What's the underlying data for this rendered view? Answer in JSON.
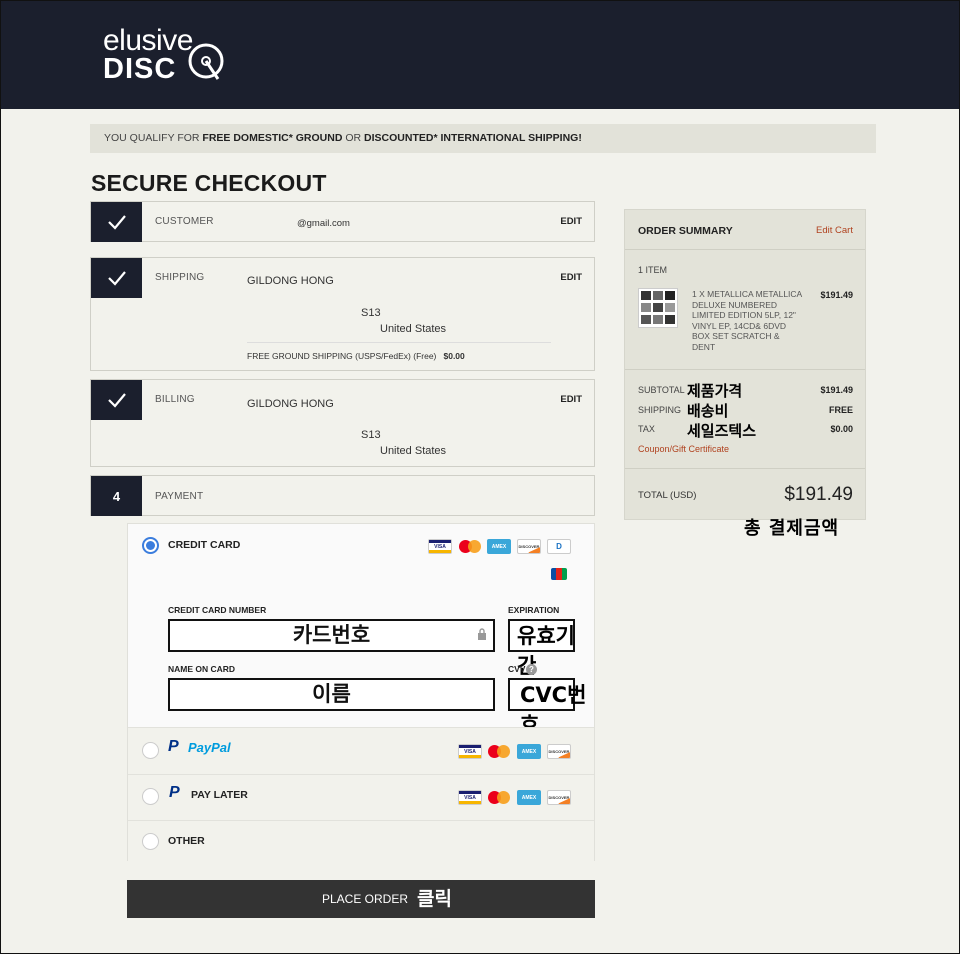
{
  "logo": {
    "line1": "elusive",
    "line2": "DISC"
  },
  "banner": {
    "pre": "YOU QUALIFY FOR ",
    "b1": "FREE DOMESTIC* GROUND",
    "mid": " OR ",
    "b2": "DISCOUNTED* INTERNATIONAL SHIPPING!"
  },
  "page_title": "SECURE CHECKOUT",
  "steps": {
    "customer": {
      "title": "CUSTOMER",
      "email": "@gmail.com",
      "edit": "EDIT"
    },
    "shipping": {
      "title": "SHIPPING",
      "name": "GILDONG HONG",
      "addr": "S13",
      "country": "United States",
      "method": "FREE GROUND SHIPPING (USPS/FedEx) (Free)",
      "cost": "$0.00",
      "edit": "EDIT"
    },
    "billing": {
      "title": "BILLING",
      "name": "GILDONG HONG",
      "addr": "S13",
      "country": "United States",
      "edit": "EDIT"
    },
    "payment": {
      "number": "4",
      "title": "PAYMENT"
    }
  },
  "payment": {
    "credit_card": {
      "label": "CREDIT CARD",
      "number_label": "CREDIT CARD NUMBER",
      "number_value": "카드번호",
      "expiration_label": "EXPIRATION",
      "expiration_value": "유효기간",
      "name_label": "NAME ON CARD",
      "name_value": "이름",
      "cvv_label": "CVV",
      "cvv_value": "CVC번호"
    },
    "paypal": {
      "label": "PayPal",
      "p": "P"
    },
    "pay_later": {
      "label": "PAY LATER",
      "p": "P"
    },
    "other": {
      "label": "OTHER"
    },
    "card_brands": {
      "visa": "VISA",
      "amex": "AMEX",
      "discover": "DISCOVER",
      "diners": "D"
    }
  },
  "place_order": {
    "label": "PLACE ORDER",
    "annotation": "클릭"
  },
  "summary": {
    "title": "ORDER SUMMARY",
    "edit_cart": "Edit Cart",
    "item_count": "1 ITEM",
    "item_desc": "1 X METALLICA METALLICA DELUXE NUMBERED LIMITED EDITION 5LP, 12\" VINYL EP, 14CD& 6DVD BOX SET SCRATCH & DENT",
    "item_price": "$191.49",
    "subtotal_label": "SUBTOTAL",
    "subtotal_anno": "제품가격",
    "subtotal_value": "$191.49",
    "shipping_label": "SHIPPING",
    "shipping_anno": "배송비",
    "shipping_value": "FREE",
    "tax_label": "TAX",
    "tax_anno": "세일즈텍스",
    "tax_value": "$0.00",
    "coupon": "Coupon/Gift Certificate",
    "total_label": "TOTAL (USD)",
    "total_value": "$191.49",
    "total_anno": "총 결제금액"
  },
  "colors": {
    "header": "#1b1f2d",
    "accent_link": "#b0421f",
    "radio": "#3b7ddd"
  }
}
